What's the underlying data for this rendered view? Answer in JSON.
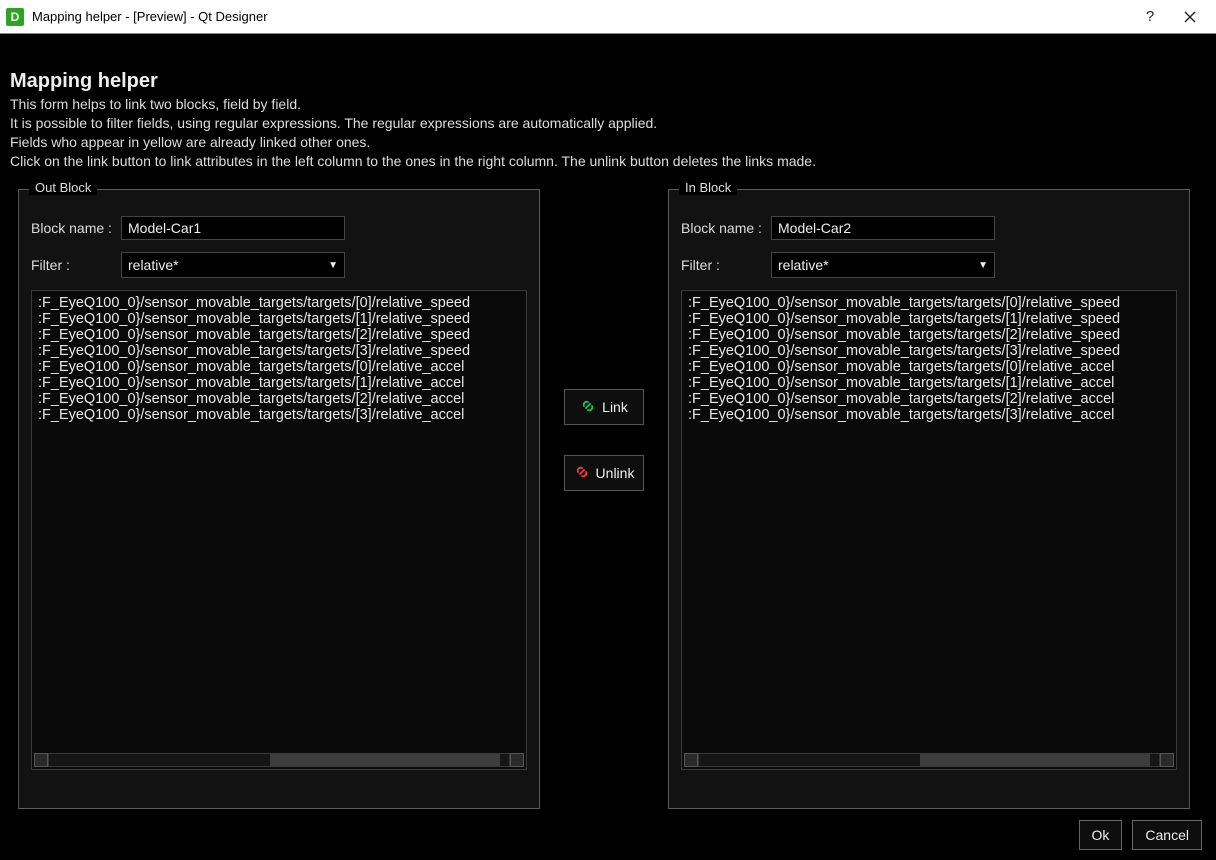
{
  "window": {
    "title": "Mapping helper - [Preview] - Qt Designer",
    "help_glyph": "?",
    "close_glyph": "✕"
  },
  "header": {
    "title": "Mapping helper",
    "line1": "This form helps to link two blocks, field by field.",
    "line2": "It is possible to filter fields, using regular expressions. The regular expressions are automatically applied.",
    "line3": "Fields who appear in yellow are already linked other ones.",
    "line4": "Click on the link button to link attributes in the left column to the ones in the right column. The unlink button deletes the links made."
  },
  "out_block": {
    "legend": "Out Block",
    "block_name_label": "Block name :",
    "block_name_value": "Model-Car1",
    "filter_label": "Filter :",
    "filter_value": "relative*",
    "items": [
      ":F_EyeQ100_0}/sensor_movable_targets/targets/[0]/relative_speed",
      ":F_EyeQ100_0}/sensor_movable_targets/targets/[1]/relative_speed",
      ":F_EyeQ100_0}/sensor_movable_targets/targets/[2]/relative_speed",
      ":F_EyeQ100_0}/sensor_movable_targets/targets/[3]/relative_speed",
      ":F_EyeQ100_0}/sensor_movable_targets/targets/[0]/relative_accel",
      ":F_EyeQ100_0}/sensor_movable_targets/targets/[1]/relative_accel",
      ":F_EyeQ100_0}/sensor_movable_targets/targets/[2]/relative_accel",
      ":F_EyeQ100_0}/sensor_movable_targets/targets/[3]/relative_accel"
    ]
  },
  "in_block": {
    "legend": "In Block",
    "block_name_label": "Block name :",
    "block_name_value": "Model-Car2",
    "filter_label": "Filter :",
    "filter_value": "relative*",
    "items": [
      ":F_EyeQ100_0}/sensor_movable_targets/targets/[0]/relative_speed",
      ":F_EyeQ100_0}/sensor_movable_targets/targets/[1]/relative_speed",
      ":F_EyeQ100_0}/sensor_movable_targets/targets/[2]/relative_speed",
      ":F_EyeQ100_0}/sensor_movable_targets/targets/[3]/relative_speed",
      ":F_EyeQ100_0}/sensor_movable_targets/targets/[0]/relative_accel",
      ":F_EyeQ100_0}/sensor_movable_targets/targets/[1]/relative_accel",
      ":F_EyeQ100_0}/sensor_movable_targets/targets/[2]/relative_accel",
      ":F_EyeQ100_0}/sensor_movable_targets/targets/[3]/relative_accel"
    ]
  },
  "actions": {
    "link_label": "Link",
    "unlink_label": "Unlink"
  },
  "footer": {
    "ok": "Ok",
    "cancel": "Cancel"
  }
}
